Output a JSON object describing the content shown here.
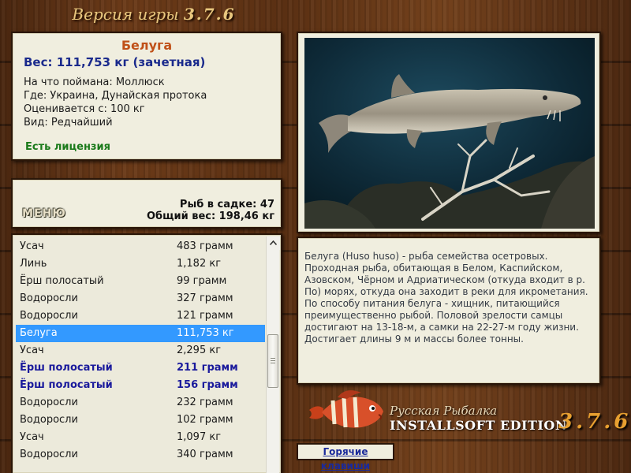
{
  "header": {
    "title": "Версия игры",
    "version": "3.7.6"
  },
  "fish": {
    "name": "Белуга",
    "weight": "Вес: 111,753 кг (зачетная)",
    "bait": "На что поймана: Моллюск",
    "location": "Где: Украина, Дунайская протока",
    "valued": "Оценивается с: 100 кг",
    "rarity": "Вид: Редчайший",
    "license": "Есть лицензия"
  },
  "cage": {
    "menu_label": "МЕНЮ",
    "count": "Рыб в садке: 47",
    "total": "Общий вес: 198,46 кг"
  },
  "catch_list": [
    {
      "name": "Усач",
      "weight": "483 грамм",
      "state": "normal"
    },
    {
      "name": "Линь",
      "weight": "1,182 кг",
      "state": "normal"
    },
    {
      "name": "Ёрш полосатый",
      "weight": "99 грамм",
      "state": "normal"
    },
    {
      "name": "Водоросли",
      "weight": "327 грамм",
      "state": "normal"
    },
    {
      "name": "Водоросли",
      "weight": "121 грамм",
      "state": "normal"
    },
    {
      "name": "Белуга",
      "weight": "111,753 кг",
      "state": "selected"
    },
    {
      "name": "Усач",
      "weight": "2,295 кг",
      "state": "normal"
    },
    {
      "name": "Ёрш полосатый",
      "weight": "211 грамм",
      "state": "bold"
    },
    {
      "name": "Ёрш полосатый",
      "weight": "156 грамм",
      "state": "bold"
    },
    {
      "name": "Водоросли",
      "weight": "232 грамм",
      "state": "normal"
    },
    {
      "name": "Водоросли",
      "weight": "102 грамм",
      "state": "normal"
    },
    {
      "name": "Усач",
      "weight": "1,097 кг",
      "state": "normal"
    },
    {
      "name": "Водоросли",
      "weight": "340 грамм",
      "state": "normal"
    }
  ],
  "description": "Белуга (Huso huso) - рыба семейства осетровых. Проходная рыба, обитающая в Белом, Каспийском, Азовском, Чёрном и Адриатическом (откуда входит в р. По) морях, откуда она заходит в реки для икрометания. По способу питания белуга - хищник, питающийся преимущественно рыбой. Половой зрелости самцы достигают на 13-18-м, а самки на 22-27-м году жизни. Достигает длины 9 м и массы более тонны.",
  "logo": {
    "line1": "Русская Рыбалка",
    "line2": "INSTALLSOFT EDITION",
    "version": "3.7.6"
  },
  "hotkeys_label": "Горячие клавиши",
  "colors": {
    "accent_name": "#c05018",
    "weight_blue": "#1a2a8c",
    "license_green": "#1a7a1a",
    "selection": "#3399ff"
  },
  "icons": {
    "photo": "beluga-sturgeon-photo",
    "logo": "red-fish-logo"
  }
}
